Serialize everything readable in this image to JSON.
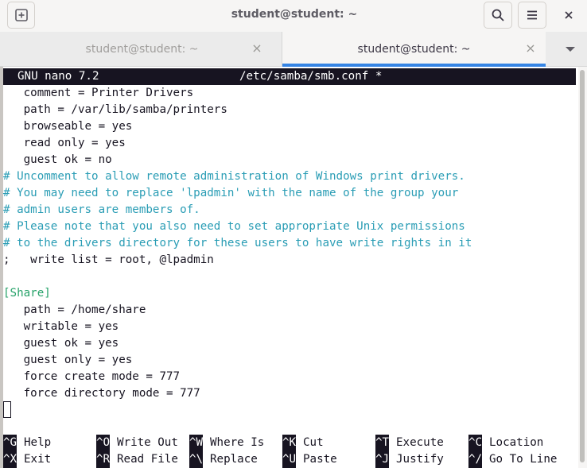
{
  "window": {
    "title": "student@student: ~",
    "new_tab_icon": "new-tab-icon",
    "search_icon": "search-icon",
    "menu_icon": "hamburger-menu-icon",
    "close_icon": "close-icon",
    "close_glyph": "×"
  },
  "tabs": [
    {
      "label": "student@student: ~",
      "close": "×",
      "active": false
    },
    {
      "label": "student@student: ~",
      "close": "×",
      "active": true
    }
  ],
  "tabs_dropdown_icon": "chevron-down-icon",
  "nano": {
    "version": "GNU nano 7.2",
    "filename": "/etc/samba/smb.conf *"
  },
  "file_lines": [
    "   comment = Printer Drivers",
    "   path = /var/lib/samba/printers",
    "   browseable = yes",
    "   read only = yes",
    "   guest ok = no",
    "# Uncomment to allow remote administration of Windows print drivers.",
    "# You may need to replace 'lpadmin' with the name of the group your",
    "# admin users are members of.",
    "# Please note that you also need to set appropriate Unix permissions",
    "# to the drivers directory for these users to have write rights in it",
    ";   write list = root, @lpadmin",
    "",
    "[Share]",
    "   path = /home/share",
    "   writable = yes",
    "   guest ok = yes",
    "   guest only = yes",
    "   force create mode = 777",
    "   force directory mode = 777"
  ],
  "shortcuts": [
    {
      "key": "^G",
      "label": "Help"
    },
    {
      "key": "^O",
      "label": "Write Out"
    },
    {
      "key": "^W",
      "label": "Where Is"
    },
    {
      "key": "^K",
      "label": "Cut"
    },
    {
      "key": "^T",
      "label": "Execute"
    },
    {
      "key": "^C",
      "label": "Location"
    },
    {
      "key": "^X",
      "label": "Exit"
    },
    {
      "key": "^R",
      "label": "Read File"
    },
    {
      "key": "^\\",
      "label": "Replace"
    },
    {
      "key": "^U",
      "label": "Paste"
    },
    {
      "key": "^J",
      "label": "Justify"
    },
    {
      "key": "^/",
      "label": "Go To Line"
    }
  ],
  "colors": {
    "comment": "#2a9db5",
    "section": "#26a269",
    "accent": "#3584e4",
    "terminal_fg": "#171421",
    "terminal_bg": "#ffffff"
  }
}
